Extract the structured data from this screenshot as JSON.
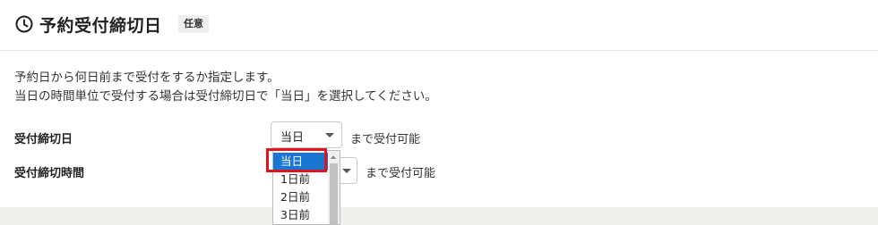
{
  "section": {
    "title": "予約受付締切日",
    "badge": "任意",
    "icon": "clock-icon"
  },
  "description": {
    "line1": "予約日から何日前まで受付をするか指定します。",
    "line2": "当日の時間単位で受付する場合は受付締切日で「当日」を選択してください。"
  },
  "fields": {
    "deadline_day": {
      "label": "受付締切日",
      "value": "当日",
      "suffix": "まで受付可能"
    },
    "deadline_time": {
      "label": "受付締切時間",
      "suffix": "まで受付可能"
    }
  },
  "dropdown": {
    "options": [
      "当日",
      "1日前",
      "2日前",
      "3日前"
    ],
    "selected_index": 0
  },
  "colors": {
    "selected_bg": "#1976d2",
    "highlight": "#e0141c"
  }
}
